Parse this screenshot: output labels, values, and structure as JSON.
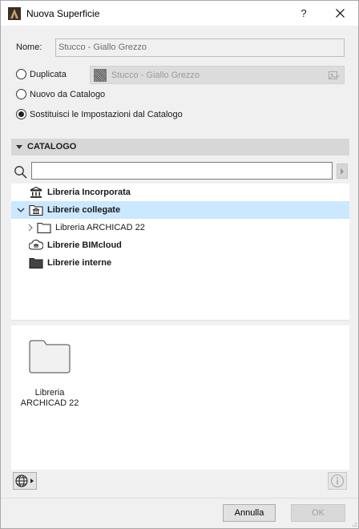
{
  "window": {
    "title": "Nuova Superficie",
    "help_label": "?",
    "close_label": "✕"
  },
  "form": {
    "name_label": "Nome:",
    "name_value": "Stucco - Giallo Grezzo",
    "options": [
      {
        "label": "Duplicata",
        "checked": false
      },
      {
        "label": "Nuovo da Catalogo",
        "checked": false
      },
      {
        "label": "Sostituisci le Impostazioni dal Catalogo",
        "checked": true
      }
    ],
    "duplicate_value": "Stucco - Giallo Grezzo"
  },
  "catalog": {
    "header": "CATALOGO",
    "search_value": "",
    "tree": [
      {
        "label": "Libreria Incorporata",
        "bold": true,
        "icon": "library-icon"
      },
      {
        "label": "Librerie collegate",
        "bold": true,
        "icon": "linked-library-icon",
        "expanded": true,
        "selected": true
      },
      {
        "label": "Libreria ARCHICAD 22",
        "bold": false,
        "icon": "folder-icon"
      },
      {
        "label": "Librerie BIMcloud",
        "bold": true,
        "icon": "bimcloud-icon"
      },
      {
        "label": "Librerie interne",
        "bold": true,
        "icon": "folder-filled-icon"
      }
    ],
    "content_items": [
      {
        "label_line1": "Libreria",
        "label_line2": "ARCHICAD 22"
      }
    ]
  },
  "buttons": {
    "cancel": "Annulla",
    "ok": "OK"
  }
}
